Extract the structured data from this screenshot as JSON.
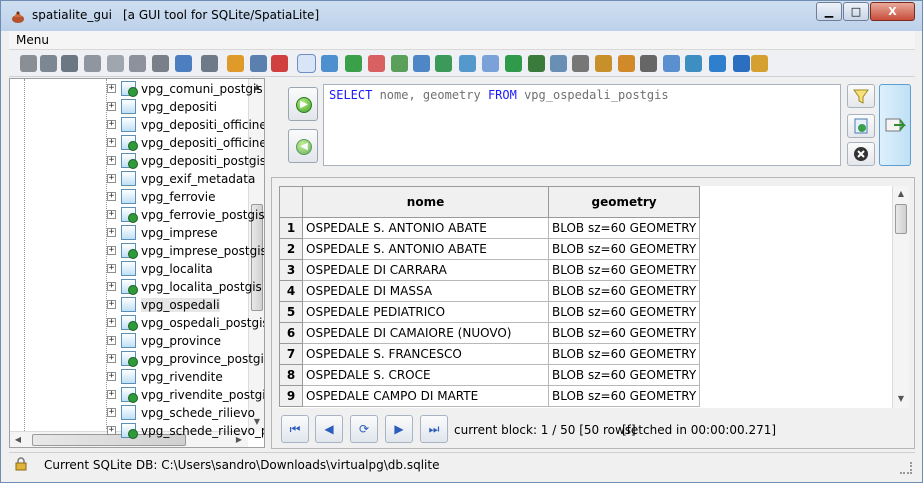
{
  "window": {
    "app_name": "spatialite_gui",
    "subtitle": "[a GUI tool for SQLite/SpatiaLite]",
    "minimize_label": "▁",
    "maximize_label": "□",
    "close_label": "X"
  },
  "menu": {
    "label": "Menu"
  },
  "toolbar": {
    "icons": [
      "connect-icon",
      "disconnect-icon",
      "create-db-icon",
      "memory-db-icon",
      "memory-save-icon",
      "memory-load-icon",
      "memory-export-icon",
      "vacuum-icon",
      "sql-script-icon",
      "load-shp-icon",
      "virtual-shp-icon",
      "network-icon",
      "query-view-composer-icon",
      "attach-db-icon",
      "sql-log-icon",
      "spatialite-version-icon",
      "charset-icon",
      "load-txt-icon",
      "virtual-csv-icon",
      "load-dbf-icon",
      "virtual-dbf-icon",
      "load-xl-icon",
      "virtual-xl-icon",
      "load-xml-icon",
      "srids-icon",
      "check-geometry-icon",
      "sanitize-icon",
      "dxf-icon",
      "blob-icon",
      "wfs-icon",
      "help-icon",
      "about-icon",
      "exit-icon"
    ]
  },
  "tree": {
    "items": [
      {
        "label": "vpg_comuni_postgis",
        "geo": true
      },
      {
        "label": "vpg_depositi",
        "geo": false
      },
      {
        "label": "vpg_depositi_officine",
        "geo": false
      },
      {
        "label": "vpg_depositi_officine_p",
        "geo": true
      },
      {
        "label": "vpg_depositi_postgis",
        "geo": true
      },
      {
        "label": "vpg_exif_metadata",
        "geo": false
      },
      {
        "label": "vpg_ferrovie",
        "geo": false
      },
      {
        "label": "vpg_ferrovie_postgis",
        "geo": true
      },
      {
        "label": "vpg_imprese",
        "geo": false
      },
      {
        "label": "vpg_imprese_postgis",
        "geo": true
      },
      {
        "label": "vpg_localita",
        "geo": false
      },
      {
        "label": "vpg_localita_postgis",
        "geo": true
      },
      {
        "label": "vpg_ospedali",
        "geo": false
      },
      {
        "label": "vpg_ospedali_postgis",
        "geo": true
      },
      {
        "label": "vpg_province",
        "geo": false
      },
      {
        "label": "vpg_province_postgis",
        "geo": true
      },
      {
        "label": "vpg_rivendite",
        "geo": false
      },
      {
        "label": "vpg_rivendite_postgis",
        "geo": true
      },
      {
        "label": "vpg_schede_rilievo",
        "geo": false
      },
      {
        "label": "vpg_schede_rilievo_p",
        "geo": true
      }
    ],
    "selected_index": 12
  },
  "sql": {
    "kw_select": "SELECT",
    "columns": " nome, geometry ",
    "kw_from": "FROM",
    "table": " vpg_ospedali_postgis"
  },
  "results": {
    "headers": [
      "nome",
      "geometry"
    ],
    "rows": [
      [
        "1",
        "OSPEDALE S. ANTONIO ABATE",
        "BLOB sz=60 GEOMETRY"
      ],
      [
        "2",
        "OSPEDALE S. ANTONIO ABATE",
        "BLOB sz=60 GEOMETRY"
      ],
      [
        "3",
        "OSPEDALE DI CARRARA",
        "BLOB sz=60 GEOMETRY"
      ],
      [
        "4",
        "OSPEDALE DI MASSA",
        "BLOB sz=60 GEOMETRY"
      ],
      [
        "5",
        "OSPEDALE PEDIATRICO",
        "BLOB sz=60 GEOMETRY"
      ],
      [
        "6",
        "OSPEDALE DI CAMAIORE (NUOVO)",
        "BLOB sz=60 GEOMETRY"
      ],
      [
        "7",
        "OSPEDALE S. FRANCESCO",
        "BLOB sz=60 GEOMETRY"
      ],
      [
        "8",
        "OSPEDALE S. CROCE",
        "BLOB sz=60 GEOMETRY"
      ],
      [
        "9",
        "OSPEDALE CAMPO DI MARTE",
        "BLOB sz=60 GEOMETRY"
      ]
    ]
  },
  "nav": {
    "current_block": "current block: 1 / 50 [50 rows]",
    "fetched": "[fetched in 00:00:00.271]"
  },
  "status": {
    "text": "Current SQLite DB: C:\\Users\\sandro\\Downloads\\virtualpg\\db.sqlite"
  },
  "colors": {
    "keyword": "#1a1aff",
    "sql_text": "#707070",
    "accent": "#2a5dbd"
  }
}
